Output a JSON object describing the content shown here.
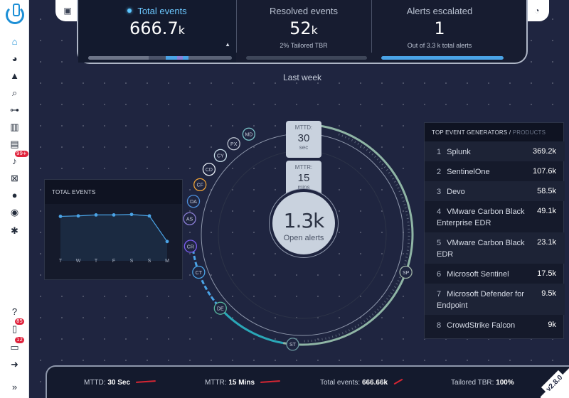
{
  "sidebar": {
    "items": [
      {
        "name": "home",
        "icon": "home-icon",
        "glyph": "⌂",
        "active": true
      },
      {
        "name": "dashboard",
        "icon": "gauge-icon",
        "glyph": "◕"
      },
      {
        "name": "alerts",
        "icon": "warning-icon",
        "glyph": "▲"
      },
      {
        "name": "search",
        "icon": "search-icon",
        "glyph": "⌕"
      },
      {
        "name": "workflow",
        "icon": "flow-icon",
        "glyph": "⊶"
      },
      {
        "name": "buildings",
        "icon": "building-icon",
        "glyph": "▥"
      },
      {
        "name": "reports",
        "icon": "report-icon",
        "glyph": "▤"
      },
      {
        "name": "notifications",
        "icon": "bell-icon",
        "glyph": "♪",
        "badge": "99+"
      },
      {
        "name": "inbox",
        "icon": "inbox-icon",
        "glyph": "⊠"
      },
      {
        "name": "user",
        "icon": "user-icon",
        "glyph": "●"
      },
      {
        "name": "visibility",
        "icon": "eye-icon",
        "glyph": "◉"
      },
      {
        "name": "settings",
        "icon": "gear-icon",
        "glyph": "✱"
      },
      {
        "name": "help",
        "icon": "help-icon",
        "glyph": "?"
      },
      {
        "name": "documents",
        "icon": "document-icon",
        "glyph": "▯",
        "badge": "85"
      },
      {
        "name": "clipboard",
        "icon": "clipboard-icon",
        "glyph": "▭",
        "badge": "12"
      },
      {
        "name": "logout",
        "icon": "logout-icon",
        "glyph": "➜"
      },
      {
        "name": "expand",
        "icon": "double-chevron-right-icon",
        "glyph": "»"
      }
    ]
  },
  "tabs": {
    "total": {
      "label": "Total events",
      "value": "666.7",
      "unit": "k",
      "progress": 0.5
    },
    "resolved": {
      "label": "Resolved events",
      "value": "52",
      "unit": "k",
      "sub": "2% Tailored TBR",
      "progress": 0.0
    },
    "escalated": {
      "label": "Alerts escalated",
      "value": "1",
      "unit": "",
      "sub": "Out of 3.3 k total alerts",
      "progress": 1.0
    }
  },
  "period": "Last week",
  "total_events_panel": {
    "title": "TOTAL EVENTS",
    "chart_data": {
      "type": "area",
      "categories": [
        "T",
        "W",
        "T",
        "F",
        "S",
        "S",
        "M"
      ],
      "values": [
        0.92,
        0.93,
        0.95,
        0.95,
        0.96,
        0.93,
        0.4
      ],
      "ylim": [
        0,
        1
      ],
      "grid": false
    }
  },
  "center": {
    "mttd_label": "MTTD:",
    "mttd_value": "30",
    "mttd_unit": "sec",
    "mttr_label": "MTTR:",
    "mttr_value": "15",
    "mttr_unit": "mins",
    "open_alerts_value": "1.3k",
    "open_alerts_label": "Open alerts",
    "sources": [
      {
        "code": "MD",
        "color": "#7bc5c9"
      },
      {
        "code": "PX",
        "color": "#bcc3cf"
      },
      {
        "code": "CY",
        "color": "#c7dde8"
      },
      {
        "code": "CD",
        "color": "#e8eef5"
      },
      {
        "code": "CF",
        "color": "#f0a336"
      },
      {
        "code": "DA",
        "color": "#4d8fdb"
      },
      {
        "code": "AS",
        "color": "#8b7fd6"
      },
      {
        "code": "CR",
        "color": "#7a5cf0"
      },
      {
        "code": "CT",
        "color": "#4aa3e6"
      },
      {
        "code": "DE",
        "color": "#58b9a0"
      },
      {
        "code": "ST",
        "color": "#6c9aa0"
      },
      {
        "code": "SP",
        "color": "#9fb3a6"
      }
    ]
  },
  "generators": {
    "title": "TOP EVENT GENERATORS /",
    "title_muted": "PRODUCTS",
    "rows": [
      {
        "rank": "1",
        "name": "Splunk",
        "value": "369.2k"
      },
      {
        "rank": "2",
        "name": "SentinelOne",
        "value": "107.6k"
      },
      {
        "rank": "3",
        "name": "Devo",
        "value": "58.5k"
      },
      {
        "rank": "4",
        "name": "VMware Carbon Black Enterprise EDR",
        "value": "49.1k"
      },
      {
        "rank": "5",
        "name": "VMware Carbon Black EDR",
        "value": "23.1k"
      },
      {
        "rank": "6",
        "name": "Microsoft Sentinel",
        "value": "17.5k"
      },
      {
        "rank": "7",
        "name": "Microsoft Defender for Endpoint",
        "value": "9.5k"
      },
      {
        "rank": "8",
        "name": "CrowdStrike Falcon",
        "value": "9k"
      }
    ]
  },
  "bottom": {
    "mttd_label": "MTTD:",
    "mttd_value": "30 Sec",
    "mttr_label": "MTTR:",
    "mttr_value": "15 Mins",
    "total_label": "Total events:",
    "total_value": "666.66k",
    "tbr_label": "Tailored TBR:",
    "tbr_value": "100%",
    "version": "v2.8.0"
  },
  "colors": {
    "accent": "#4aa3e6",
    "brand": "#1c8fd6",
    "alert": "#e0233d",
    "ring_green": "#8fb5a5"
  }
}
